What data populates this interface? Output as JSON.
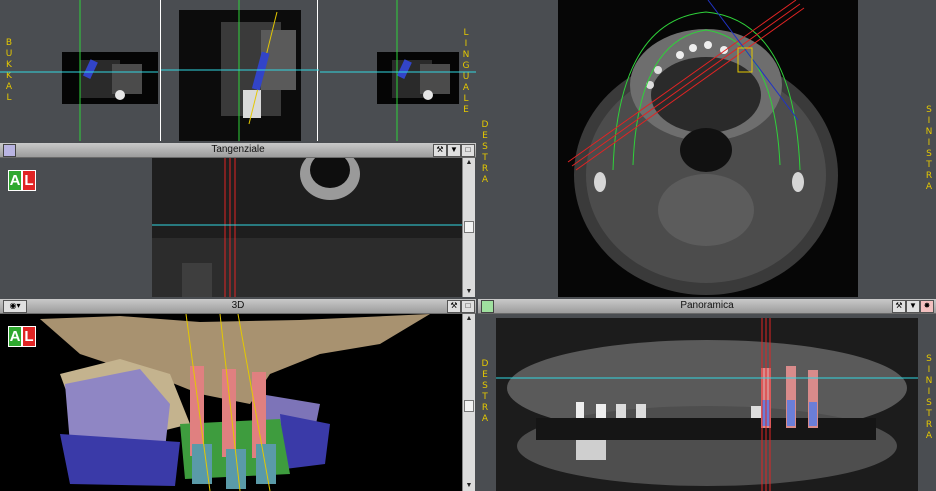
{
  "axial_labels": {
    "left": "BUKKAL",
    "right": "LINGUALE"
  },
  "orientation": {
    "right_patient": "DESTRA",
    "left_patient": "SINISTRA"
  },
  "panels": {
    "tangential": {
      "title": "Tangenziale"
    },
    "three_d": {
      "title": "3D"
    },
    "panoramic": {
      "title": "Panoramica"
    }
  },
  "al_badge": {
    "a": "A",
    "l": "L"
  },
  "colors": {
    "accent_green": "#2fd13a",
    "cyan_line": "#31d6e0",
    "red_line": "#e02424",
    "yellow": "#e4c800"
  },
  "icons": [
    "tools-icon",
    "pin-icon",
    "maximize-icon",
    "eye-icon",
    "settings-icon"
  ]
}
